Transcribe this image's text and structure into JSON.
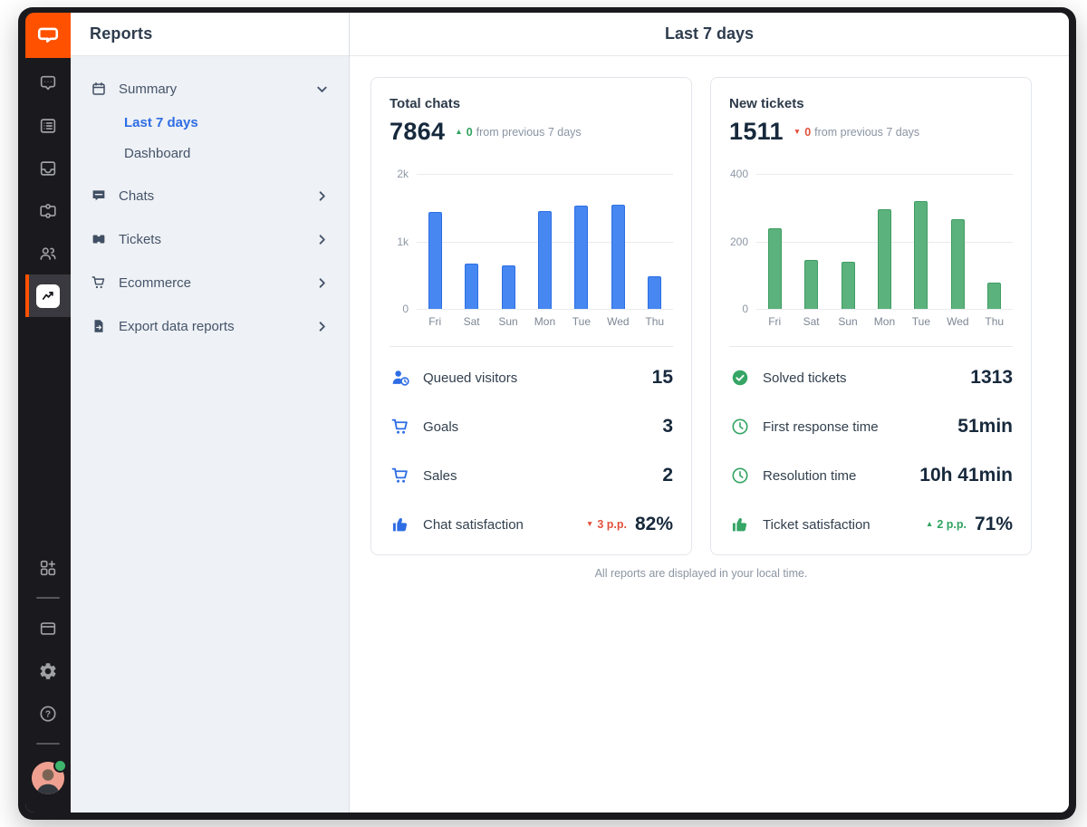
{
  "colors": {
    "brand_orange": "#ff5100",
    "link_blue": "#2e6de4",
    "positive_green": "#2fa35f",
    "negative_red": "#e2503c",
    "bar_blue": "#4687f1",
    "bar_green": "#5cb27c"
  },
  "rail": {
    "icons": [
      "chat-bubble-icon",
      "engage-list-icon",
      "inbox-icon",
      "ticket-icon",
      "team-icon",
      "reports-icon"
    ],
    "active_icon": "reports-icon",
    "bottom_icons": [
      "apps-plus-icon",
      "billing-card-icon",
      "gear-icon",
      "help-icon",
      "avatar"
    ]
  },
  "sidebar": {
    "title": "Reports",
    "summary": {
      "label": "Summary",
      "icon": "calendar-icon",
      "expanded": true
    },
    "summary_children": [
      {
        "label": "Last 7 days",
        "active": true
      },
      {
        "label": "Dashboard",
        "active": false
      }
    ],
    "sections": [
      {
        "label": "Chats",
        "icon": "chat-flag-icon"
      },
      {
        "label": "Tickets",
        "icon": "ticket-icon"
      },
      {
        "label": "Ecommerce",
        "icon": "cart-icon"
      },
      {
        "label": "Export data reports",
        "icon": "export-file-icon"
      }
    ]
  },
  "header": {
    "title": "Last 7 days"
  },
  "cards": [
    {
      "title": "Total chats",
      "total": "7864",
      "delta_arrow": "▲",
      "delta_value": "0",
      "delta_text": "from previous 7 days",
      "stats": [
        {
          "icon": "queued-visitors-icon",
          "label": "Queued visitors",
          "value": "15"
        },
        {
          "icon": "cart-icon",
          "label": "Goals",
          "value": "3"
        },
        {
          "icon": "cart-icon",
          "label": "Sales",
          "value": "2"
        },
        {
          "icon": "thumb-up-icon",
          "label": "Chat satisfaction",
          "delta_arrow": "▼",
          "delta": "3 p.p.",
          "value": "82%"
        }
      ]
    },
    {
      "title": "New tickets",
      "total": "1511",
      "delta_arrow": "▼",
      "delta_value": "0",
      "delta_text": "from previous 7 days",
      "stats": [
        {
          "icon": "check-circle-icon",
          "label": "Solved tickets",
          "value": "1313"
        },
        {
          "icon": "clock-icon",
          "label": "First response time",
          "value": "51min"
        },
        {
          "icon": "clock-icon",
          "label": "Resolution time",
          "value": "10h 41min"
        },
        {
          "icon": "thumb-up-icon",
          "label": "Ticket satisfaction",
          "delta_arrow": "▲",
          "delta": "2 p.p.",
          "value": "71%"
        }
      ]
    }
  ],
  "chart_data": [
    {
      "type": "bar",
      "title": "Total chats",
      "categories": [
        "Fri",
        "Sat",
        "Sun",
        "Mon",
        "Tue",
        "Wed",
        "Thu"
      ],
      "values": [
        1440,
        665,
        650,
        1455,
        1530,
        1545,
        485
      ],
      "ylim": [
        0,
        2000
      ],
      "yticks": [
        "2k",
        "1k",
        "0"
      ],
      "grid": true,
      "legend": false,
      "bar_fill": "#4687f1",
      "bar_border": "#2d6fe3"
    },
    {
      "type": "bar",
      "title": "New tickets",
      "categories": [
        "Fri",
        "Sat",
        "Sun",
        "Mon",
        "Tue",
        "Wed",
        "Thu"
      ],
      "values": [
        240,
        145,
        140,
        295,
        320,
        265,
        78
      ],
      "ylim": [
        0,
        400
      ],
      "yticks": [
        "400",
        "200",
        "0"
      ],
      "grid": true,
      "legend": false,
      "bar_fill": "#5cb27c",
      "bar_border": "#3f9c63"
    }
  ],
  "footnote": "All reports are displayed in your local time."
}
